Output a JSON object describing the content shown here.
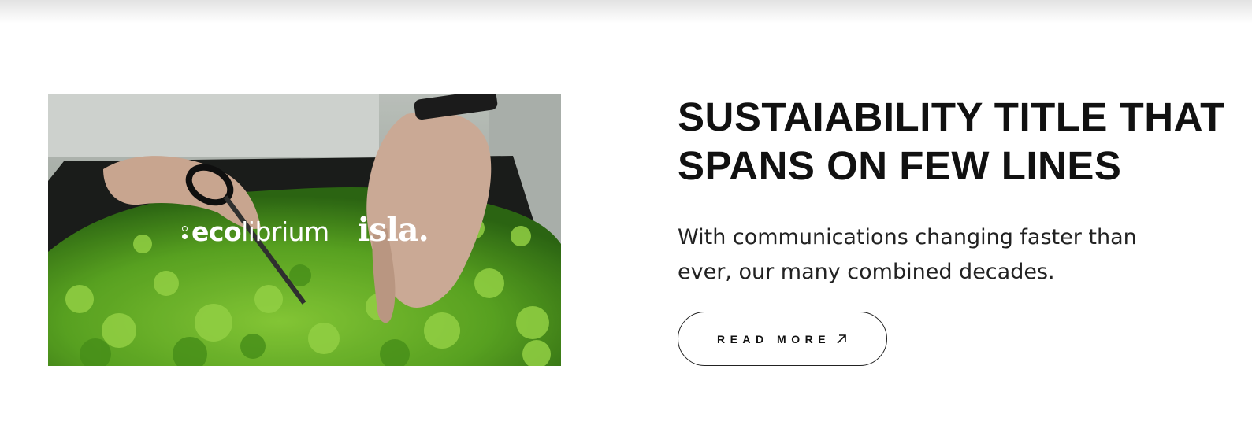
{
  "feature": {
    "image": {
      "logos": {
        "primary_light": "eco",
        "primary_rest": "librium",
        "secondary": "isla."
      }
    },
    "title": "SUSTAIABILITY TITLE THAT SPANS ON FEW LINES",
    "description": "With communications changing faster than ever, our many combined decades.",
    "button": {
      "label": "READ MORE",
      "icon": "arrow-up-right-icon"
    }
  },
  "colors": {
    "text": "#111111",
    "background": "#ffffff",
    "foliage": "#6dbb2c"
  }
}
